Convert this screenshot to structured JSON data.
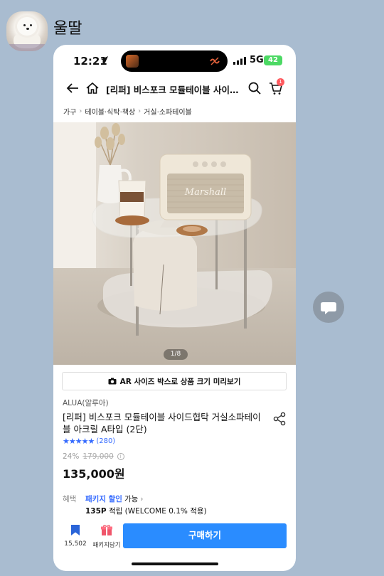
{
  "chat": {
    "sender_name": "울딸"
  },
  "status_bar": {
    "time": "12:21",
    "network": "5G",
    "battery": "42"
  },
  "navbar": {
    "title": "[리퍼] 비스포크 모듈테이블 사이드협...",
    "cart_badge": "1"
  },
  "breadcrumb": [
    "가구",
    "테이블·식탁·책상",
    "거실·소파테이블"
  ],
  "image": {
    "counter": "1/8",
    "speaker_brand": "Marshall"
  },
  "ar_bar": {
    "label": "AR 사이즈 박스로 상품 크기 미리보기"
  },
  "product": {
    "brand": "ALUA(알루아)",
    "name": "[리퍼] 비스포크 모듈테이블 사이드협탁 거실소파테이블 아크릴 A타입 (2단)",
    "rating_stars": 5,
    "review_count": "(280)",
    "discount_rate": "24%",
    "original_price": "179,000",
    "price": "135,000원"
  },
  "benefits": {
    "label": "혜택",
    "package_discount": "패키지 할인",
    "available": "가능",
    "points_amount": "135P",
    "points_text": "적립 (WELCOME 0.1% 적용)"
  },
  "bottom_bar": {
    "wish_count": "15,502",
    "package_label": "패키지담기",
    "buy_label": "구매하기"
  },
  "colors": {
    "chat_background": "#a9bcd0",
    "accent": "#2a8cff",
    "star": "#346aff"
  }
}
